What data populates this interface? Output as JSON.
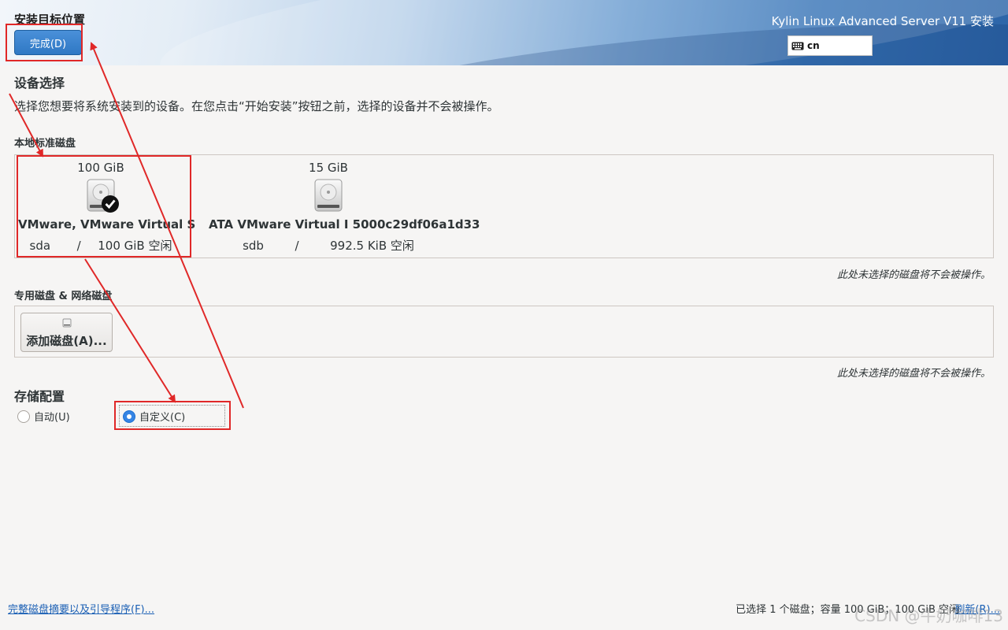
{
  "header": {
    "page_title": "安装目标位置",
    "done_button": "完成(D)",
    "product_title": "Kylin Linux Advanced Server V11 安装",
    "keyboard_layout": "cn"
  },
  "device_selection": {
    "title": "设备选择",
    "description": "选择您想要将系统安装到的设备。在您点击“开始安装”按钮之前，选择的设备并不会被操作。"
  },
  "local_disks": {
    "title": "本地标准磁盘",
    "disks": [
      {
        "size": "100 GiB",
        "name": "VMware, VMware Virtual S",
        "device": "sda",
        "separator": "/",
        "free": "100 GiB 空闲",
        "selected": true
      },
      {
        "size": "15 GiB",
        "name": "ATA VMware Virtual I 5000c29df06a1d33",
        "device": "sdb",
        "separator": "/",
        "free": "992.5 KiB 空闲",
        "selected": false
      }
    ],
    "note": "此处未选择的磁盘将不会被操作。"
  },
  "special_disks": {
    "title": "专用磁盘 & 网络磁盘",
    "add_button": "添加磁盘(A)...",
    "note": "此处未选择的磁盘将不会被操作。"
  },
  "storage_config": {
    "title": "存储配置",
    "options": [
      {
        "label": "自动(U)",
        "checked": false
      },
      {
        "label": "自定义(C)",
        "checked": true
      }
    ]
  },
  "footer": {
    "summary_link": "完整磁盘摘要以及引导程序(F)...",
    "status": "已选择 1 个磁盘；容量 100 GiB；100 GiB 空闲",
    "refresh_link": "刷新(R)..."
  },
  "watermark": "CSDN @牛奶咖啡13",
  "colors": {
    "accent": "#3584e4",
    "annotation_red": "#e02828",
    "link": "#1a5fb4"
  }
}
